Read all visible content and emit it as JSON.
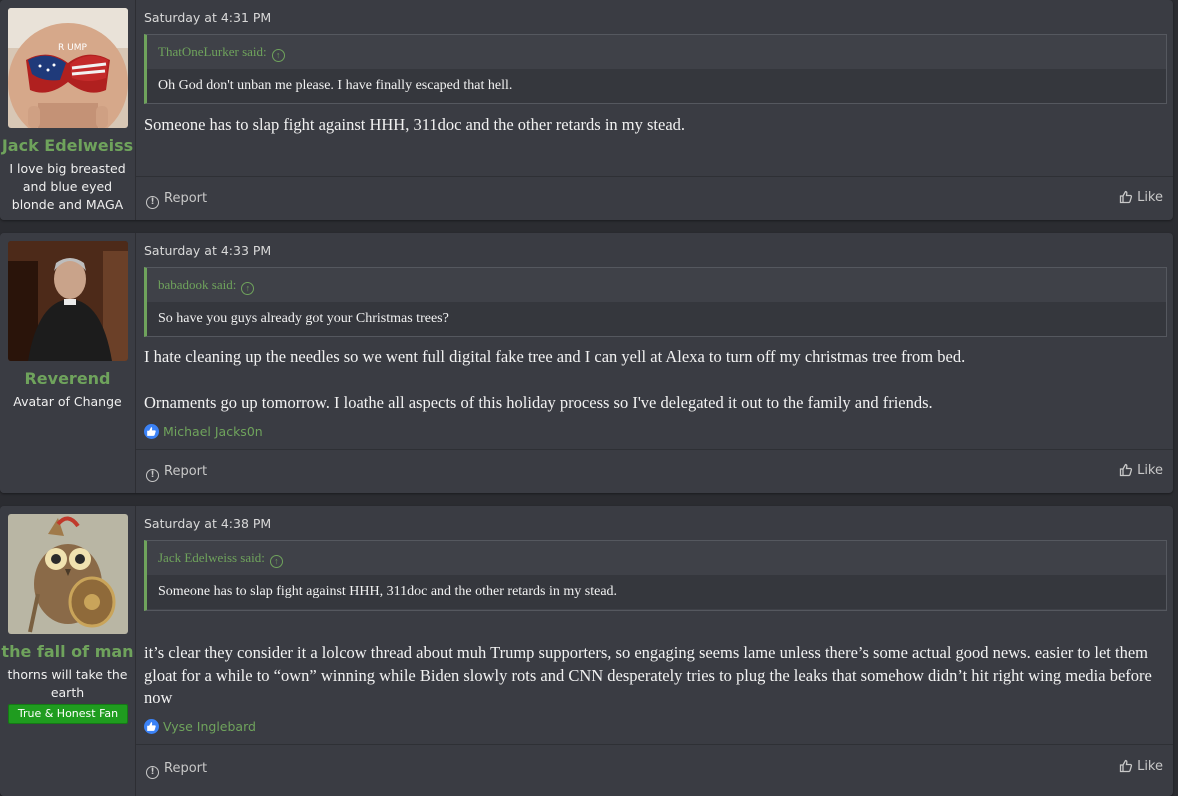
{
  "posts": [
    {
      "author": "Jack Edelweiss",
      "user_title": "I love big breasted and blue eyed blonde and MAGA",
      "date": "Saturday at 4:31 PM",
      "quote": {
        "author": "ThatOneLurker said:",
        "text": "Oh God don't unban me please. I have finally escaped that hell."
      },
      "body": [
        "Someone has to slap fight against HHH, 311doc and the other retards in my stead."
      ],
      "reactions": "",
      "report_label": "Report",
      "like_label": "Like"
    },
    {
      "author": "Reverend",
      "user_title": "Avatar of Change",
      "date": "Saturday at 4:33 PM",
      "quote": {
        "author": "babadook said:",
        "text": "So have you guys already got your Christmas trees?"
      },
      "body": [
        "I hate cleaning up the needles so we went full digital fake tree and I can yell at Alexa to turn off my christmas tree from bed.",
        "Ornaments go up tomorrow. I loathe all aspects of this holiday process so I've delegated it out to the family and friends."
      ],
      "reactions": "Michael Jacks0n",
      "report_label": "Report",
      "like_label": "Like"
    },
    {
      "author": "the fall of man",
      "user_title": "thorns will take the earth",
      "user_badge": "True & Honest Fan",
      "date": "Saturday at 4:38 PM",
      "quote": {
        "author": "Jack Edelweiss said:",
        "text": "Someone has to slap fight against HHH, 311doc and the other retards in my stead."
      },
      "body": [
        "it’s clear they consider it a lolcow thread about muh Trump supporters, so engaging seems lame unless there’s some actual good news. easier to let them gloat for a while to “own” winning while Biden slowly rots and CNN desperately tries to plug the leaks that somehow didn’t hit right wing media before now"
      ],
      "reactions": "Vyse Inglebard",
      "report_label": "Report",
      "like_label": "Like"
    }
  ],
  "colors": {
    "accent": "#6fa35c",
    "badge": "#1f9c1f",
    "reaction": "#3b82f6",
    "post_bg": "#3a3c43",
    "page_bg": "#2b2c31"
  },
  "icons": {
    "report": "report-icon",
    "like": "thumbs-up-icon",
    "quote_jump": "arrow-up-circle-icon",
    "reaction": "like-reaction-icon"
  }
}
